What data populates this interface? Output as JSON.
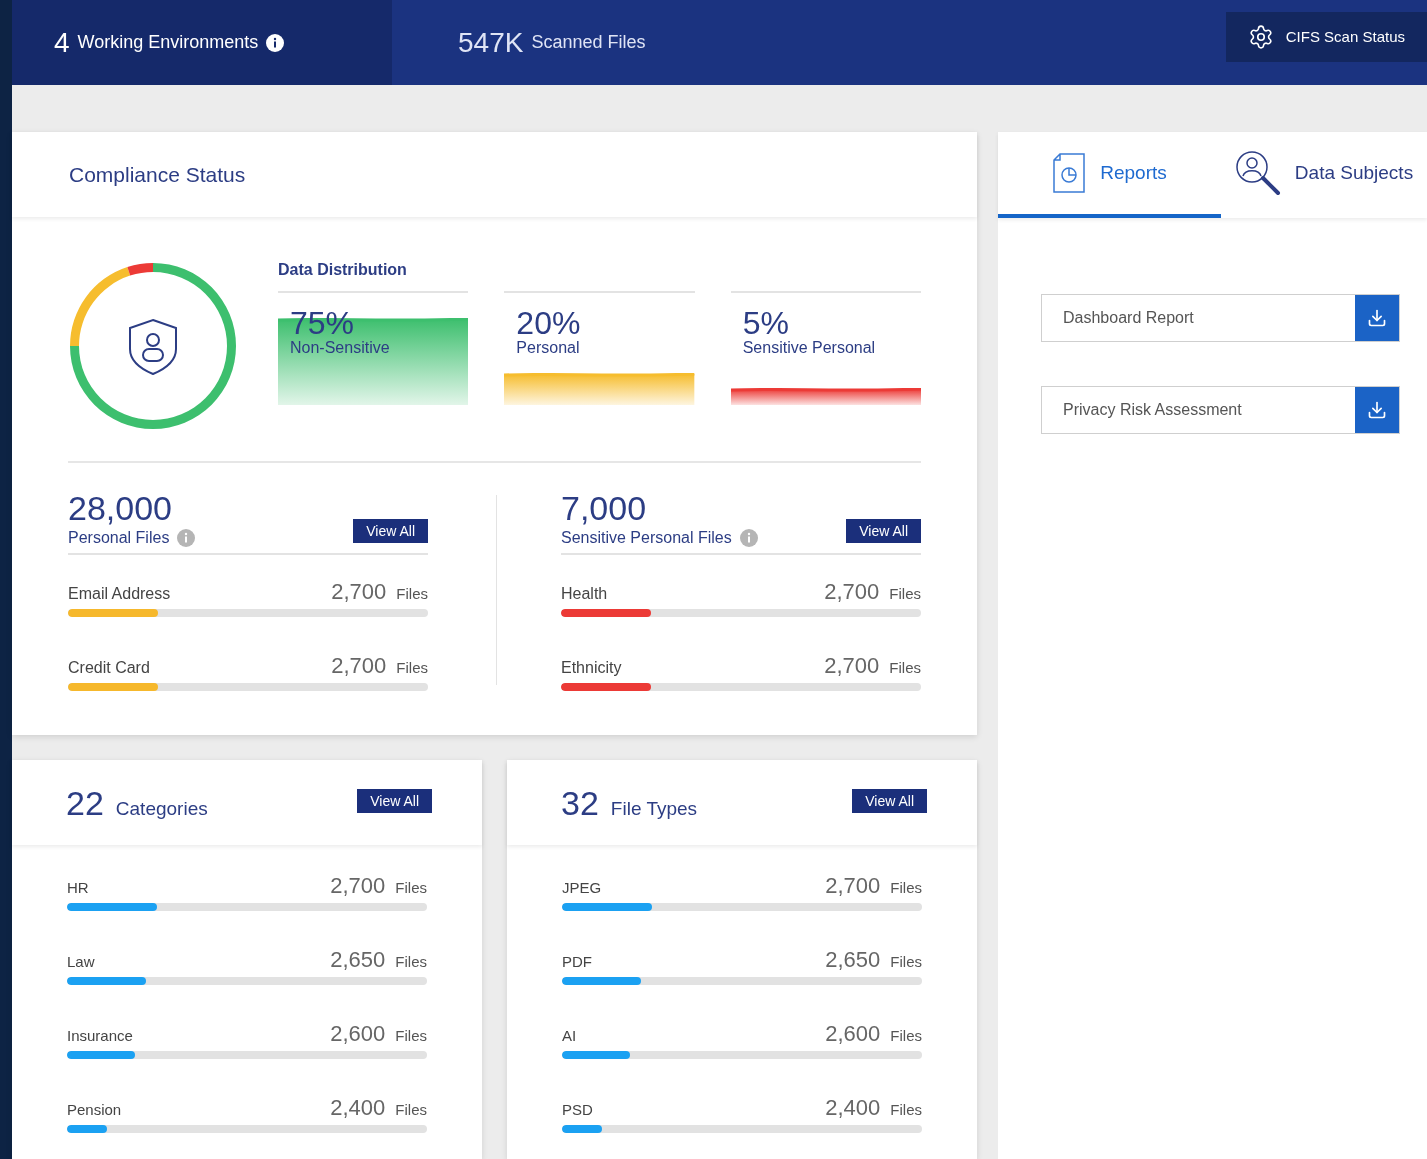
{
  "top_bar": {
    "environments": {
      "count": "4",
      "label": "Working Environments"
    },
    "scanned": {
      "count": "547K",
      "label": "Scanned Files"
    },
    "status_button": {
      "label": "CIFS Scan Status"
    }
  },
  "compliance": {
    "title": "Compliance Status",
    "distribution_title": "Data Distribution",
    "distribution": [
      {
        "percent": "75%",
        "label": "Non-Sensitive",
        "color": "#3dbf6e"
      },
      {
        "percent": "20%",
        "label": "Personal",
        "color": "#f6bd2e"
      },
      {
        "percent": "5%",
        "label": "Sensitive Personal",
        "color": "#ec3a36"
      }
    ],
    "chart_data": {
      "type": "donut",
      "values": [
        75,
        20,
        5
      ]
    },
    "groups": [
      {
        "kind": "personal",
        "count": "28,000",
        "label": "Personal Files",
        "button": "View All",
        "items": [
          {
            "name": "Email Address",
            "count": "2,700",
            "unit": "Files",
            "level": 0.25
          },
          {
            "name": "Credit Card",
            "count": "2,700",
            "unit": "Files",
            "level": 0.25
          }
        ]
      },
      {
        "kind": "sensitive",
        "count": "7,000",
        "label": "Sensitive Personal Files",
        "button": "View All",
        "items": [
          {
            "name": "Health",
            "count": "2,700",
            "unit": "Files",
            "level": 0.25
          },
          {
            "name": "Ethnicity",
            "count": "2,700",
            "unit": "Files",
            "level": 0.25
          }
        ]
      }
    ]
  },
  "cards": [
    {
      "count": "22",
      "label": "Categories",
      "button": "View All",
      "items": [
        {
          "name": "HR",
          "count": "2,700",
          "unit": "Files",
          "level": 0.25
        },
        {
          "name": "Law",
          "count": "2,650",
          "unit": "Files",
          "level": 0.22
        },
        {
          "name": "Insurance",
          "count": "2,600",
          "unit": "Files",
          "level": 0.19
        },
        {
          "name": "Pension",
          "count": "2,400",
          "unit": "Files",
          "level": 0.11
        }
      ]
    },
    {
      "count": "32",
      "label": "File Types",
      "button": "View All",
      "items": [
        {
          "name": "JPEG",
          "count": "2,700",
          "unit": "Files",
          "level": 0.25
        },
        {
          "name": "PDF",
          "count": "2,650",
          "unit": "Files",
          "level": 0.22
        },
        {
          "name": "AI",
          "count": "2,600",
          "unit": "Files",
          "level": 0.19
        },
        {
          "name": "PSD",
          "count": "2,400",
          "unit": "Files",
          "level": 0.11
        }
      ]
    }
  ],
  "side_panel": {
    "tabs": [
      {
        "label": "Reports",
        "selected": true
      },
      {
        "label": "Data Subjects",
        "selected": false
      }
    ],
    "reports": [
      {
        "name": "Dashboard Report"
      },
      {
        "name": "Privacy Risk Assessment"
      }
    ]
  }
}
